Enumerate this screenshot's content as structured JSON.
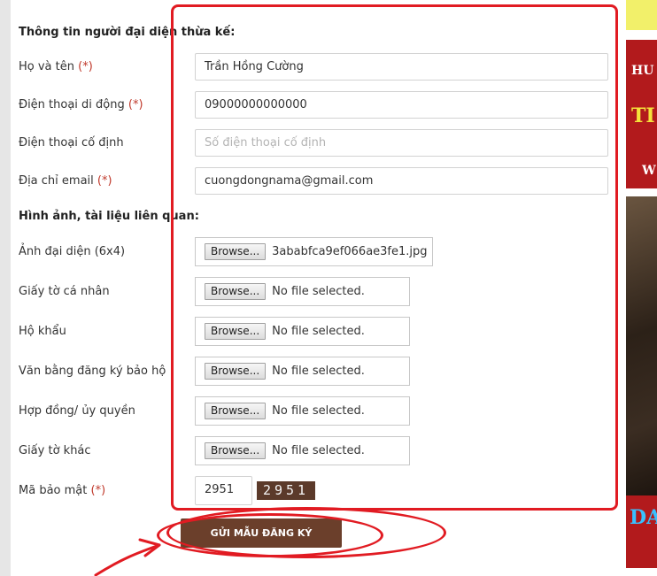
{
  "form": {
    "section_representative": "Thông tin người đại diện thừa kế:",
    "name": {
      "label": "Họ và tên",
      "required": "(*)",
      "value": "Trần Hồng Cường"
    },
    "mobile": {
      "label": "Điện thoại di động",
      "required": "(*)",
      "value": "09000000000000"
    },
    "landline": {
      "label": "Điện thoại cố định",
      "placeholder": "Số điện thoại cố định"
    },
    "email": {
      "label": "Địa chỉ email",
      "required": "(*)",
      "value": "cuongdongnama@gmail.com"
    },
    "section_documents": "Hình ảnh, tài liệu liên quan:",
    "files": [
      {
        "label": "Ảnh đại diện (6x4)",
        "button": "Browse...",
        "status": "3ababfca9ef066ae3fe1.jpg"
      },
      {
        "label": "Giấy tờ cá nhân",
        "button": "Browse...",
        "status": "No file selected."
      },
      {
        "label": "Hộ khẩu",
        "button": "Browse...",
        "status": "No file selected."
      },
      {
        "label": "Văn bằng đăng ký bảo hộ",
        "button": "Browse...",
        "status": "No file selected."
      },
      {
        "label": "Hợp đồng/ ủy quyền",
        "button": "Browse...",
        "status": "No file selected."
      },
      {
        "label": "Giấy tờ khác",
        "button": "Browse...",
        "status": "No file selected."
      }
    ],
    "captcha": {
      "label": "Mã bảo mật",
      "required": "(*)",
      "value": "2951",
      "image_text": "2951"
    },
    "submit_label": "GỬI MẪU ĐĂNG KÝ"
  },
  "sidebar": {
    "banner1_texts": [
      "HU",
      "TI",
      "W"
    ],
    "banner2_text": "DA"
  },
  "colors": {
    "annotation_red": "#e11b22",
    "submit_bg": "#6b3f2b",
    "captcha_bg": "#5b3a2a",
    "banner_red": "#b21a1c"
  }
}
